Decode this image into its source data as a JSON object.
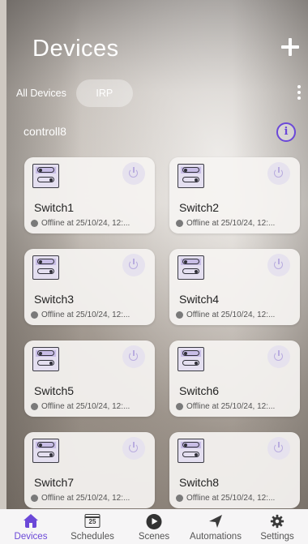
{
  "header": {
    "title": "Devices"
  },
  "tabs": {
    "all": "All Devices",
    "irp": "IRP"
  },
  "group": {
    "name": "controll8"
  },
  "devices": [
    {
      "name": "Switch1",
      "status": "Offline at 25/10/24, 12:..."
    },
    {
      "name": "Switch2",
      "status": "Offline at 25/10/24, 12:..."
    },
    {
      "name": "Switch3",
      "status": "Offline at 25/10/24, 12:..."
    },
    {
      "name": "Switch4",
      "status": "Offline at 25/10/24, 12:..."
    },
    {
      "name": "Switch5",
      "status": "Offline at 25/10/24, 12:..."
    },
    {
      "name": "Switch6",
      "status": "Offline at 25/10/24, 12:..."
    },
    {
      "name": "Switch7",
      "status": "Offline at 25/10/24, 12:..."
    },
    {
      "name": "Switch8",
      "status": "Offline at 25/10/24, 12:..."
    }
  ],
  "nav": {
    "devices": "Devices",
    "schedules": "Schedules",
    "schedules_day": "25",
    "scenes": "Scenes",
    "automations": "Automations",
    "settings": "Settings"
  },
  "colors": {
    "accent": "#6b48d8"
  }
}
